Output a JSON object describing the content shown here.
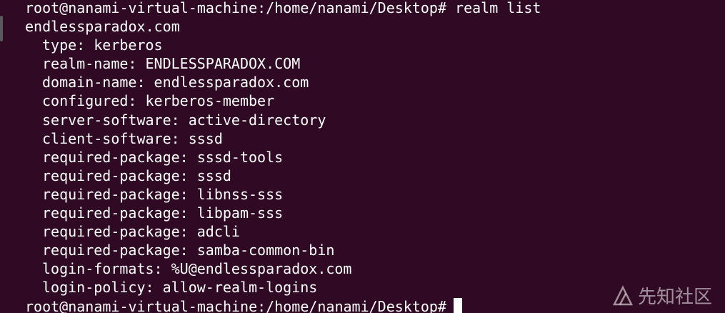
{
  "terminal": {
    "prompt_line": "root@nanami-virtual-machine:/home/nanami/Desktop# realm list",
    "realm": "endlessparadox.com",
    "details": [
      "type: kerberos",
      "realm-name: ENDLESSPARADOX.COM",
      "domain-name: endlessparadox.com",
      "configured: kerberos-member",
      "server-software: active-directory",
      "client-software: sssd",
      "required-package: sssd-tools",
      "required-package: sssd",
      "required-package: libnss-sss",
      "required-package: libpam-sss",
      "required-package: adcli",
      "required-package: samba-common-bin",
      "login-formats: %U@endlessparadox.com",
      "login-policy: allow-realm-logins"
    ],
    "final_prompt": "root@nanami-virtual-machine:/home/nanami/Desktop#"
  },
  "watermark": {
    "icon": "xianzhi-logo-icon",
    "text": "先知社区"
  },
  "colors": {
    "background": "#300a24",
    "foreground": "#ffffff"
  }
}
